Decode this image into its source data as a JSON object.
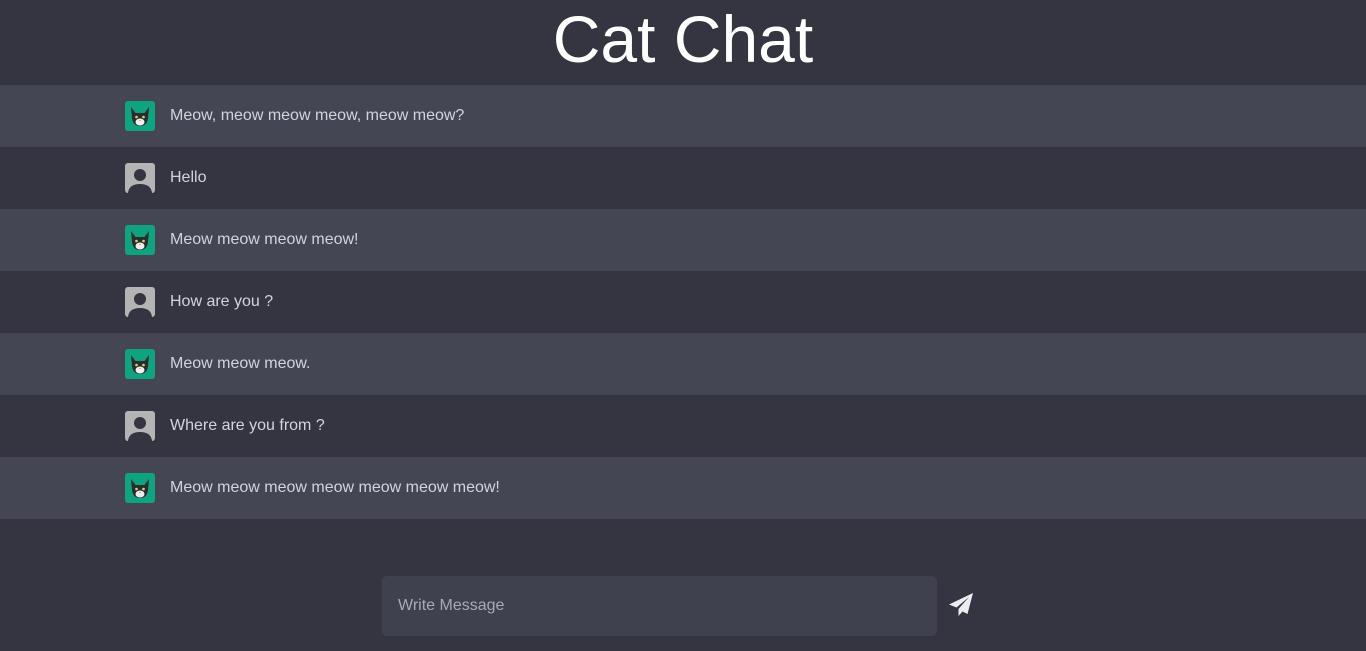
{
  "header": {
    "title": "Cat Chat"
  },
  "messages": [
    {
      "sender": "cat",
      "avatar_icon": "cat-avatar-icon",
      "text": "Meow, meow meow meow, meow meow?"
    },
    {
      "sender": "user",
      "avatar_icon": "user-avatar-icon",
      "text": "Hello"
    },
    {
      "sender": "cat",
      "avatar_icon": "cat-avatar-icon",
      "text": "Meow meow meow meow!"
    },
    {
      "sender": "user",
      "avatar_icon": "user-avatar-icon",
      "text": "How are you ?"
    },
    {
      "sender": "cat",
      "avatar_icon": "cat-avatar-icon",
      "text": "Meow meow meow."
    },
    {
      "sender": "user",
      "avatar_icon": "user-avatar-icon",
      "text": "Where are you from ?"
    },
    {
      "sender": "cat",
      "avatar_icon": "cat-avatar-icon",
      "text": "Meow meow meow meow meow meow meow!"
    }
  ],
  "composer": {
    "placeholder": "Write Message",
    "value": "",
    "send_icon": "paper-plane-icon"
  },
  "colors": {
    "background": "#343541",
    "cat_row": "#444654",
    "input_bg": "#40414f",
    "cat_avatar_bg": "#10a37f",
    "text": "#d1d5db"
  }
}
